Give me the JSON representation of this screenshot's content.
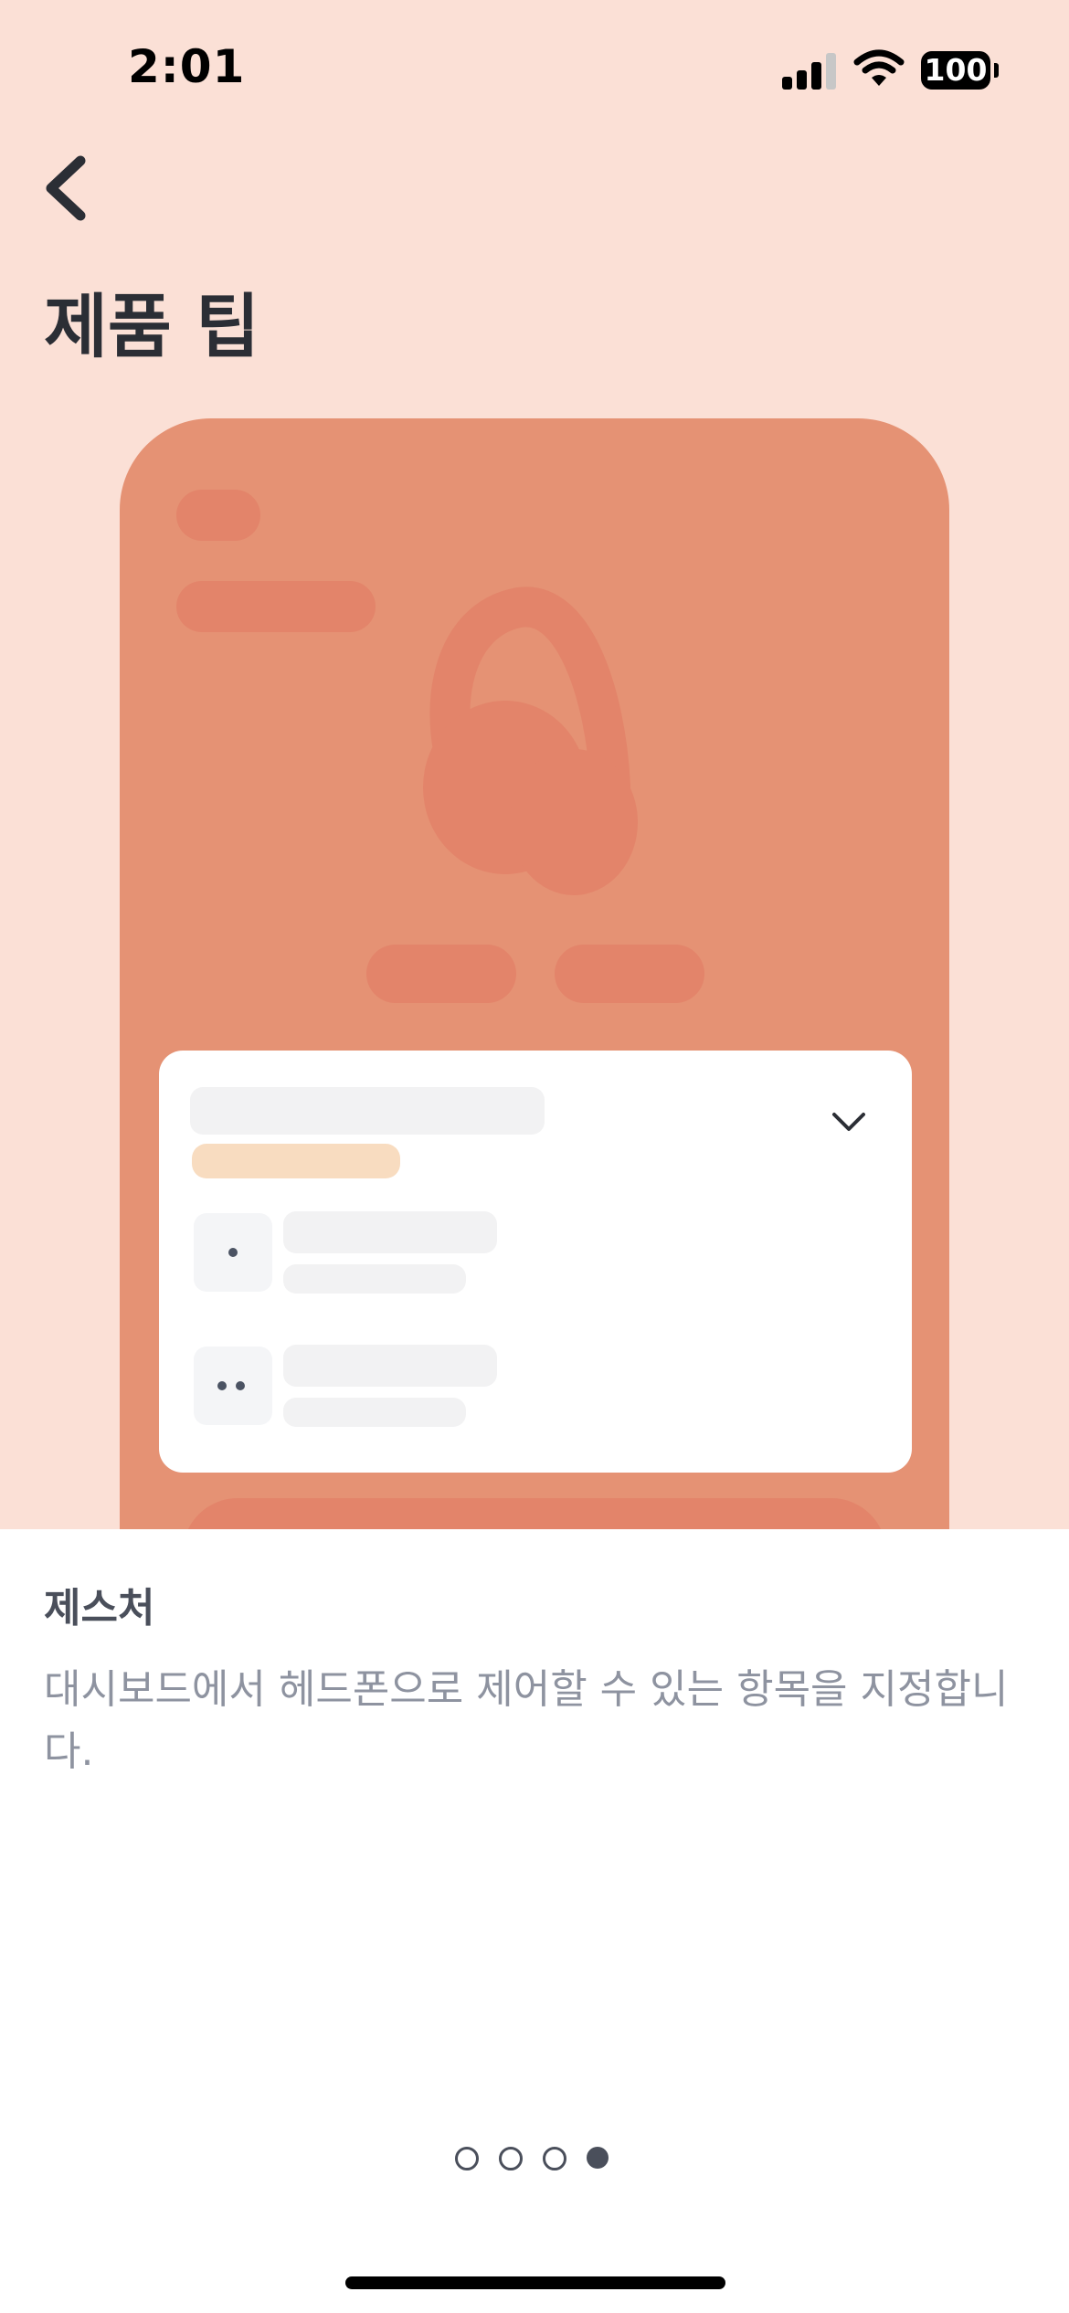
{
  "status_bar": {
    "time": "2:01",
    "battery": "100",
    "signal_icon": "cellular-signal-icon",
    "wifi_icon": "wifi-icon"
  },
  "header": {
    "back_icon": "chevron-left-icon",
    "title": "제품 팁"
  },
  "illustration": {
    "product_icon": "headphones-icon",
    "expand_icon": "chevron-down-icon",
    "colors": {
      "background": "#fbe0d6",
      "phone": "#e59274",
      "placeholder": "#e3846a",
      "card": "#ffffff",
      "highlight_bar": "#f8dcc0"
    }
  },
  "tip": {
    "title": "제스처",
    "description": "대시보드에서 헤드폰으로 제어할 수 있는 항목을 지정합니다."
  },
  "pager": {
    "total": 4,
    "current": 4
  }
}
